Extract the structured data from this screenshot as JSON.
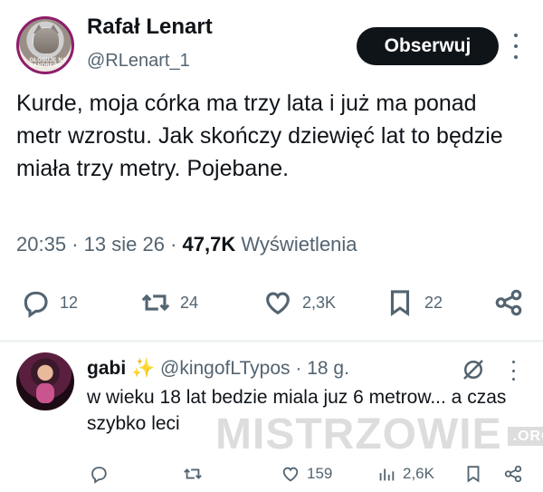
{
  "tweet": {
    "author_name": "Rafał Lenart",
    "author_handle": "@RLenart_1",
    "avatar_ring_text": "GŁOSUJĘ NA ZANDBERGA",
    "follow_label": "Obserwuj",
    "text": "Kurde, moja córka ma trzy lata i już ma ponad metr wzrostu. Jak skończy dziewięć lat to będzie miała trzy metry. Pojebane.",
    "time": "20:35",
    "date": "13 sie 26",
    "views_count": "47,7K",
    "views_label": "Wyświetlenia",
    "actions": {
      "replies": "12",
      "reposts": "24",
      "likes": "2,3K",
      "bookmarks": "22"
    }
  },
  "reply": {
    "author_name": "gabi",
    "sparkles": "✨",
    "author_handle": "@kingofLTypos",
    "age": "18 g.",
    "text": "w wieku 18 lat bedzie miala juz 6 metrow... a czas szybko leci",
    "actions": {
      "likes": "159",
      "views": "2,6K"
    }
  },
  "watermark": {
    "text": "MISTRZOWIE",
    "suffix": ".ORG"
  }
}
